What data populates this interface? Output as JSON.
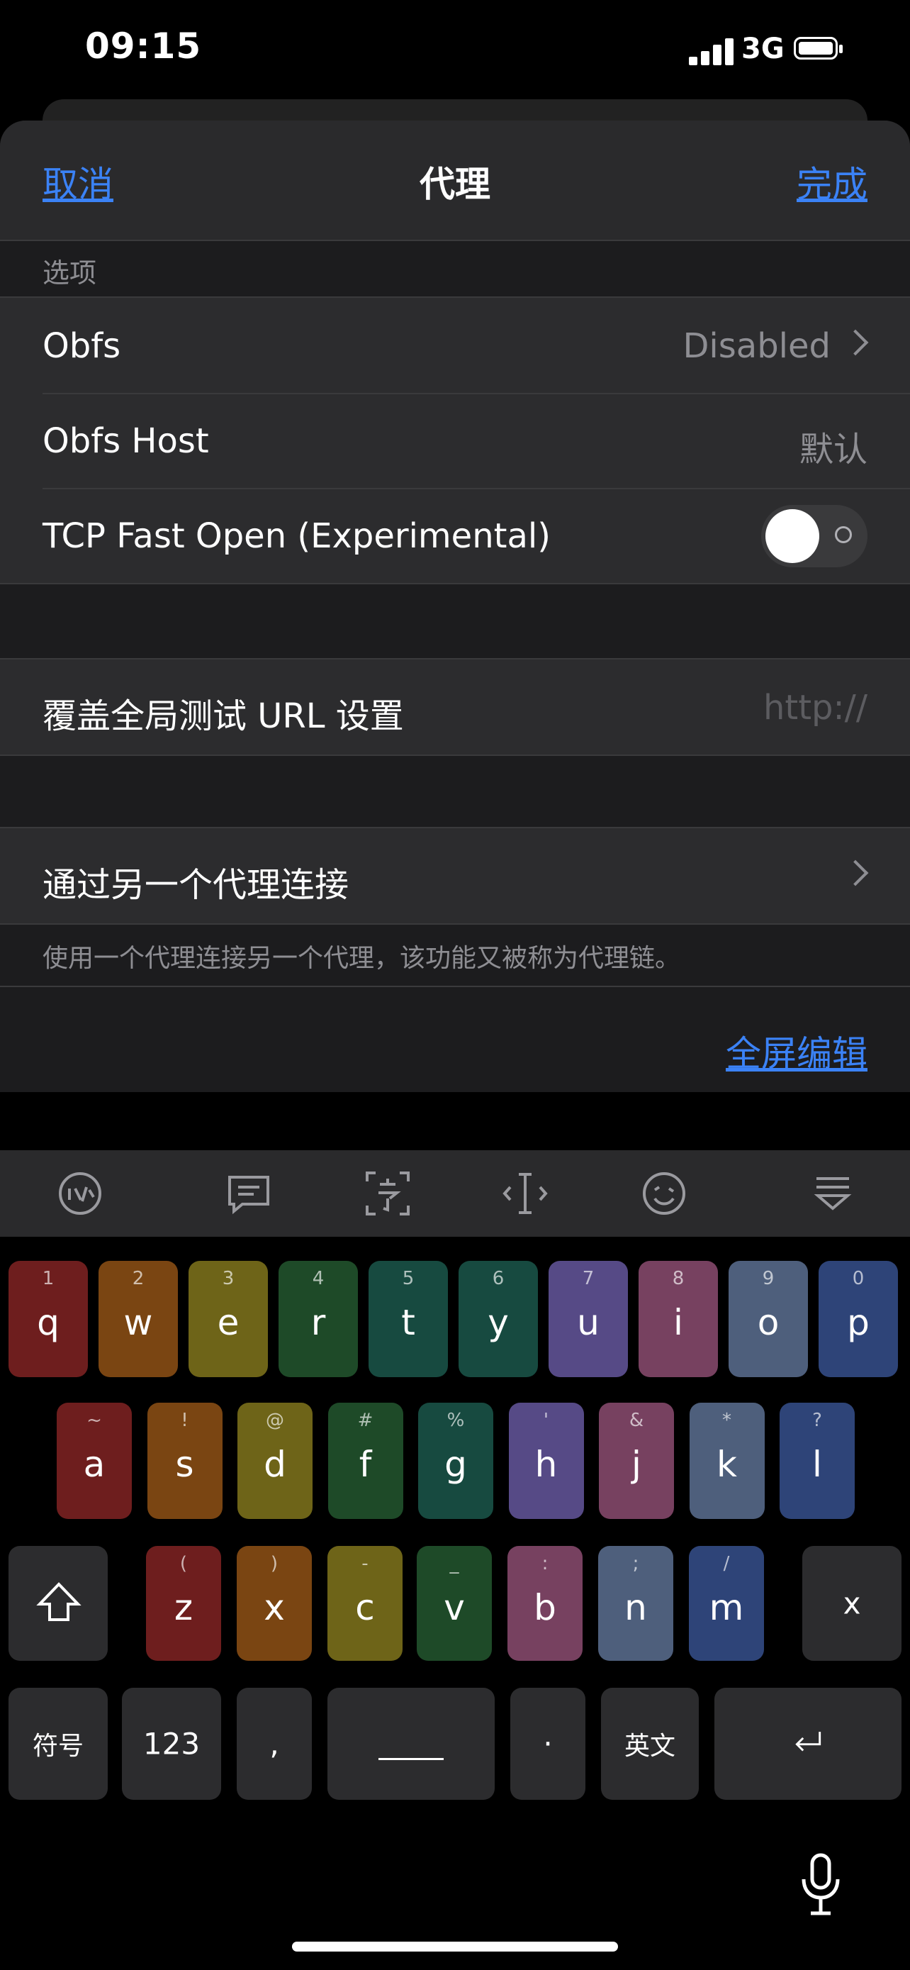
{
  "status_bar": {
    "time": "09:15",
    "network": "3G"
  },
  "nav": {
    "cancel": "取消",
    "title": "代理",
    "done": "完成"
  },
  "options": {
    "header": "选项",
    "obfs": {
      "label": "Obfs",
      "value": "Disabled"
    },
    "obfs_host": {
      "label": "Obfs Host",
      "placeholder": "默认"
    },
    "tcp_fast_open": {
      "label": "TCP Fast Open (Experimental)",
      "enabled": false
    }
  },
  "test_url": {
    "label": "覆盖全局测试 URL 设置",
    "placeholder": "http://"
  },
  "proxy_chain": {
    "label": "通过另一个代理连接",
    "footer": "使用一个代理连接另一个代理，该功能又被称为代理链。"
  },
  "fullscreen_edit": "全屏编辑",
  "keyboard": {
    "row1": [
      {
        "key": "q",
        "hint": "1",
        "color": "#6e1e1e"
      },
      {
        "key": "w",
        "hint": "2",
        "color": "#7a4512"
      },
      {
        "key": "e",
        "hint": "3",
        "color": "#6e6418"
      },
      {
        "key": "r",
        "hint": "4",
        "color": "#1e4a28"
      },
      {
        "key": "t",
        "hint": "5",
        "color": "#174a40"
      },
      {
        "key": "y",
        "hint": "6",
        "color": "#174a40"
      },
      {
        "key": "u",
        "hint": "7",
        "color": "#564a86"
      },
      {
        "key": "i",
        "hint": "8",
        "color": "#774160"
      },
      {
        "key": "o",
        "hint": "9",
        "color": "#4e5f7c"
      },
      {
        "key": "p",
        "hint": "0",
        "color": "#2e4478"
      }
    ],
    "row2": [
      {
        "key": "a",
        "hint": "~",
        "color": "#6e1e1e"
      },
      {
        "key": "s",
        "hint": "!",
        "color": "#7a4512"
      },
      {
        "key": "d",
        "hint": "@",
        "color": "#6e6418"
      },
      {
        "key": "f",
        "hint": "#",
        "color": "#1e4a28"
      },
      {
        "key": "g",
        "hint": "%",
        "color": "#174a40"
      },
      {
        "key": "h",
        "hint": "'",
        "color": "#564a86"
      },
      {
        "key": "j",
        "hint": "&",
        "color": "#774160"
      },
      {
        "key": "k",
        "hint": "*",
        "color": "#4e5f7c"
      },
      {
        "key": "l",
        "hint": "?",
        "color": "#2e4478"
      }
    ],
    "row3": [
      {
        "key": "z",
        "hint": "(",
        "color": "#6e1e1e"
      },
      {
        "key": "x",
        "hint": ")",
        "color": "#7a4512"
      },
      {
        "key": "c",
        "hint": "-",
        "color": "#6e6418"
      },
      {
        "key": "v",
        "hint": "_",
        "color": "#1e4a28"
      },
      {
        "key": "b",
        "hint": ":",
        "color": "#774160"
      },
      {
        "key": "n",
        "hint": ";",
        "color": "#4e5f7c"
      },
      {
        "key": "m",
        "hint": "/",
        "color": "#2e4478"
      }
    ],
    "delete": "x",
    "symbols": "符号",
    "numbers": "123",
    "comma": ",",
    "period": "·",
    "lang": "英文"
  }
}
